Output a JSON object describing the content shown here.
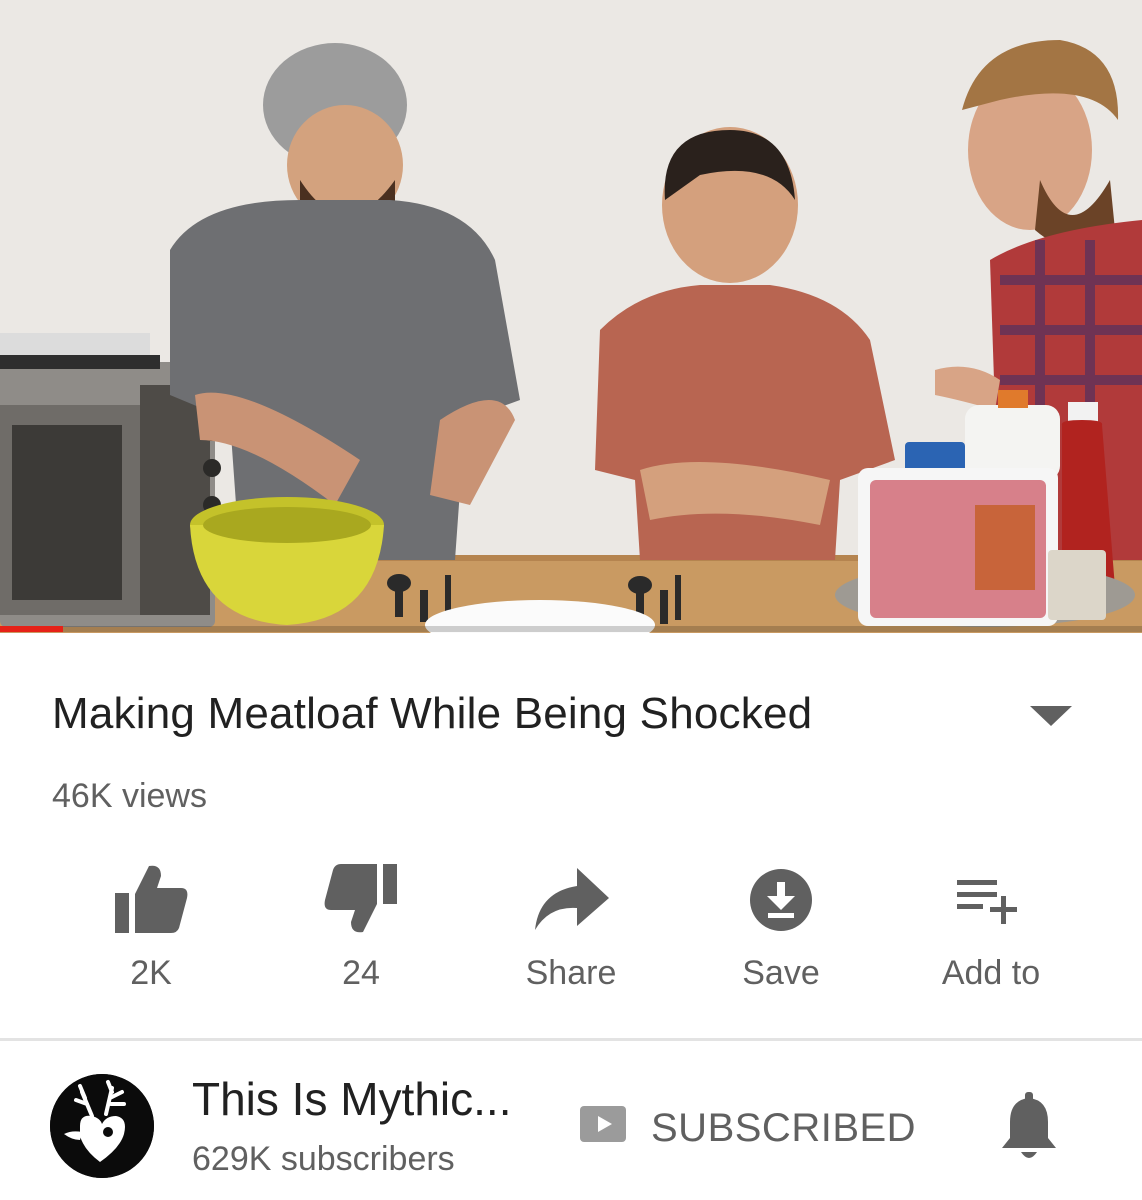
{
  "video": {
    "scene_description": "Three men at a wooden table with a yellow mixing bowl, toaster oven, ground beef tray and condiments",
    "progress_fraction": 0.055,
    "progress_color": "#e62117"
  },
  "details": {
    "title": "Making Meatloaf While Being Shocked",
    "views": "46K views",
    "expand_icon": "chevron-down-icon"
  },
  "actions": [
    {
      "id": "like",
      "icon": "thumb-up-icon",
      "label": "2K"
    },
    {
      "id": "dislike",
      "icon": "thumb-down-icon",
      "label": "24"
    },
    {
      "id": "share",
      "icon": "share-arrow-icon",
      "label": "Share"
    },
    {
      "id": "save",
      "icon": "download-circle-icon",
      "label": "Save"
    },
    {
      "id": "add_to",
      "icon": "playlist-add-icon",
      "label": "Add to"
    }
  ],
  "channel": {
    "name": "This Is Mythic...",
    "subscribers": "629K subscribers",
    "avatar_icon": "stag-heart-logo-icon",
    "subscribe_label": "SUBSCRIBED",
    "subscribe_icon": "youtube-play-icon",
    "notification_icon": "bell-icon"
  },
  "colors": {
    "text_primary": "#212121",
    "text_secondary": "#606060",
    "icon_gray": "#606060",
    "progress_red": "#e62117"
  }
}
